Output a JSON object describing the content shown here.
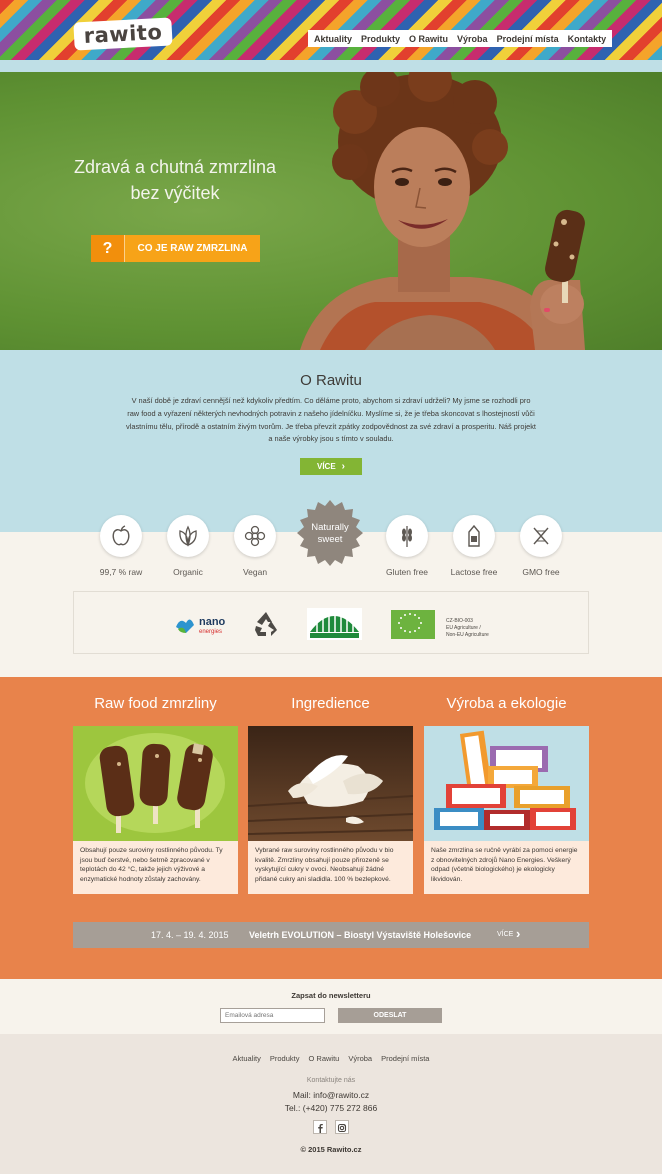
{
  "header": {
    "logo": "rawito",
    "nav": [
      "Aktuality",
      "Produkty",
      "O Rawitu",
      "Výroba",
      "Prodejní místa",
      "Kontakty"
    ]
  },
  "hero": {
    "title_line1": "Zdravá a chutná zmrzlina",
    "title_line2": "bez výčitek",
    "cta_icon": "?",
    "cta_label": "CO JE RAW ZMRZLINA"
  },
  "about": {
    "title": "O Rawitu",
    "text": "V naší době je zdraví cennější než kdykoliv předtím. Co děláme proto, abychom si zdraví udrželi? My jsme se rozhodli pro raw food a vyřazení některých nevhodných potravin z našeho jídelníčku. Myslíme si, že je třeba skoncovat s lhostejností vůči vlastnímu tělu, přírodě a ostatním živým tvorům. Je třeba převzít zpátky zodpovědnost za své zdraví a prosperitu. Náš projekt a naše výrobky jsou s tímto v souladu.",
    "more_label": "VÍCE",
    "more_icon": "chevron-right-icon"
  },
  "features": [
    {
      "label": "99,7 % raw",
      "icon": "apple-icon"
    },
    {
      "label": "Organic",
      "icon": "leaves-icon"
    },
    {
      "label": "Vegan",
      "icon": "flower-icon"
    },
    {
      "label": "Gluten free",
      "icon": "wheat-icon"
    },
    {
      "label": "Lactose free",
      "icon": "milk-carton-icon"
    },
    {
      "label": "GMO free",
      "icon": "dna-icon"
    }
  ],
  "badge": {
    "line1": "Naturally",
    "line2": "sweet"
  },
  "certifications": {
    "nano_logo": "nano energies",
    "eu_code": "CZ-BIO-003",
    "eu_line2": "EU Agriculture /",
    "eu_line3": "Non-EU Agriculture"
  },
  "columns": [
    {
      "title": "Raw food zmrzliny",
      "text": "Obsahují pouze suroviny rostlinného původu. Ty jsou buď čerstvé, nebo šetrně zpracované v teplotách do 42 °C, takže jejich výživové a enzymatické hodnoty zůstaly zachovány."
    },
    {
      "title": "Ingredience",
      "text": "Vybrané raw suroviny rostlinného původu v bio kvalitě. Zmrzliny obsahují pouze přirozeně se vyskytující cukry v ovoci. Neobsahují žádné přidané cukry ani sladidla. 100 % bezlepkové."
    },
    {
      "title": "Výroba a ekologie",
      "text": "Naše zmrzlina se ručně vyrábí za pomoci energie z obnovitelných zdrojů Nano Energies. Veškerý odpad (včetně biologického) je ekologicky likvidován."
    }
  ],
  "product_box_label": "rawito",
  "event": {
    "date": "17. 4. – 19. 4. 2015",
    "name": "Veletrh EVOLUTION – Biostyl  Výstaviště Holešovice",
    "more": "VÍCE"
  },
  "newsletter": {
    "title": "Zapsat do newsletteru",
    "placeholder": "Emailová adresa",
    "button": "ODESLAT"
  },
  "footer": {
    "nav": [
      "Aktuality",
      "Produkty",
      "O Rawitu",
      "Výroba",
      "Prodejní místa"
    ],
    "contact_heading": "Kontaktujte nás",
    "mail": "Mail: info@rawito.cz",
    "tel": "Tel.: (+420) 775 272 866",
    "social": [
      "facebook-icon",
      "instagram-icon"
    ],
    "copyright": "©  2015 Rawito.cz"
  },
  "colors": {
    "orange": "#e8834b",
    "light_blue": "#bfdfe6",
    "green_button": "#83b534",
    "cta_orange": "#f7a318",
    "grey": "#a69e96"
  }
}
